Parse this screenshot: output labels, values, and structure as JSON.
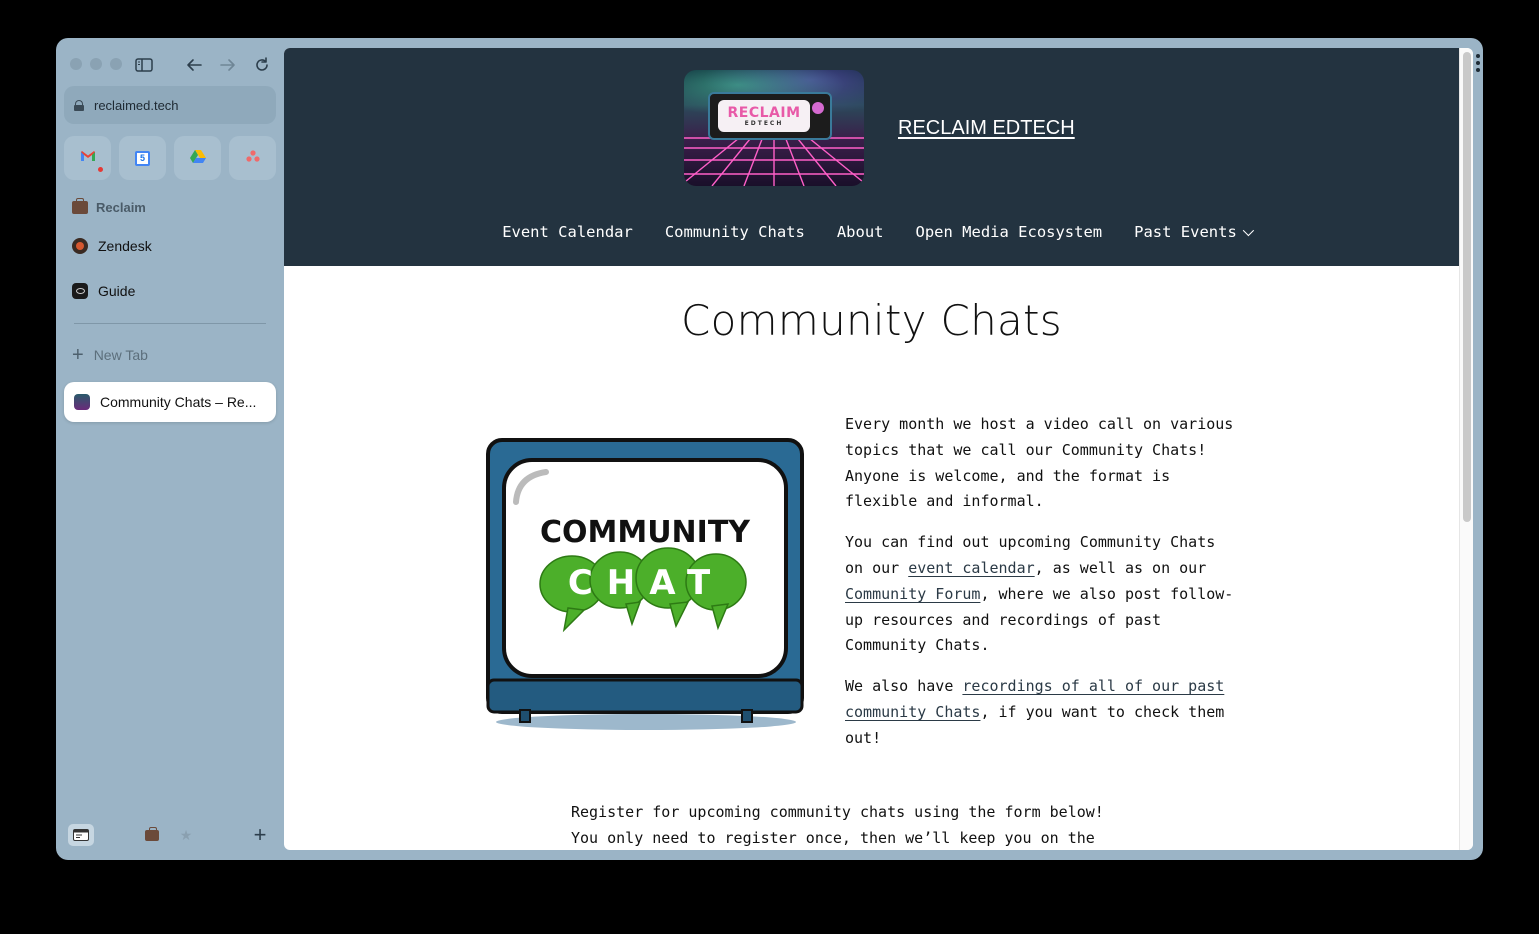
{
  "browser": {
    "url": "reclaimed.tech",
    "pinned": [
      {
        "name": "Gmail",
        "icon": "gmail-icon"
      },
      {
        "name": "Calendar",
        "icon": "calendar-icon",
        "glyph": "5"
      },
      {
        "name": "Drive",
        "icon": "drive-icon"
      },
      {
        "name": "Asana",
        "icon": "asana-icon"
      }
    ],
    "space_label": "Reclaim",
    "sidebar_items": [
      {
        "label": "Zendesk"
      },
      {
        "label": "Guide"
      }
    ],
    "new_tab_label": "New Tab",
    "active_tab_label": "Community Chats – Re..."
  },
  "site": {
    "logo_line1": "RECLAIM",
    "logo_line2": "EDTECH",
    "title": "RECLAIM EDTECH",
    "nav": [
      {
        "label": "Event Calendar"
      },
      {
        "label": "Community Chats"
      },
      {
        "label": "About"
      },
      {
        "label": "Open Media Ecosystem"
      },
      {
        "label": "Past Events",
        "has_dropdown": true
      }
    ]
  },
  "page": {
    "title": "Community Chats",
    "image_text_line1": "COMMUNITY",
    "image_text_line2": "CHAT",
    "para1": "Every month we host a video call on various topics that we call our Community Chats! Anyone is welcome, and the format is flexible and informal.",
    "para2_a": "You can find out upcoming Community Chats on our ",
    "para2_link1": "event calendar",
    "para2_b": ", as well as on our ",
    "para2_link2": "Community Forum",
    "para2_c": ", where we also post follow-up resources and recordings of past Community Chats.",
    "para3_a": "We also have ",
    "para3_link": "recordings of all of our past community Chats",
    "para3_b": ", if you want to check them out!",
    "register_line1": "Register for upcoming community chats using the form below!",
    "register_line2": "You only need to register once, then we’ll keep you on the"
  }
}
